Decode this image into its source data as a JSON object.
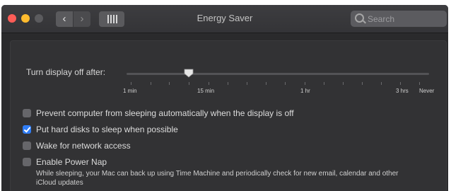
{
  "window": {
    "title": "Energy Saver",
    "traffic_lights": [
      "close",
      "minimize",
      "zoom"
    ],
    "accent_color": "#2f7df6"
  },
  "toolbar": {
    "back_icon": "‹",
    "forward_icon": "›",
    "show_all_icon": "grid-icon"
  },
  "search": {
    "placeholder": "Search",
    "value": ""
  },
  "display_sleep": {
    "label": "Turn display off after:",
    "value": "15 min",
    "ticks": [
      "1 min",
      "15 min",
      "1 hr",
      "3 hrs",
      "Never"
    ]
  },
  "options": [
    {
      "label": "Prevent computer from sleeping automatically when the display is off",
      "checked": false
    },
    {
      "label": "Put hard disks to sleep when possible",
      "checked": true
    },
    {
      "label": "Wake for network access",
      "checked": false
    },
    {
      "label": "Enable Power Nap",
      "checked": false
    }
  ],
  "power_nap_description": "While sleeping, your Mac can back up using Time Machine and periodically check for new email, calendar and other iCloud updates"
}
